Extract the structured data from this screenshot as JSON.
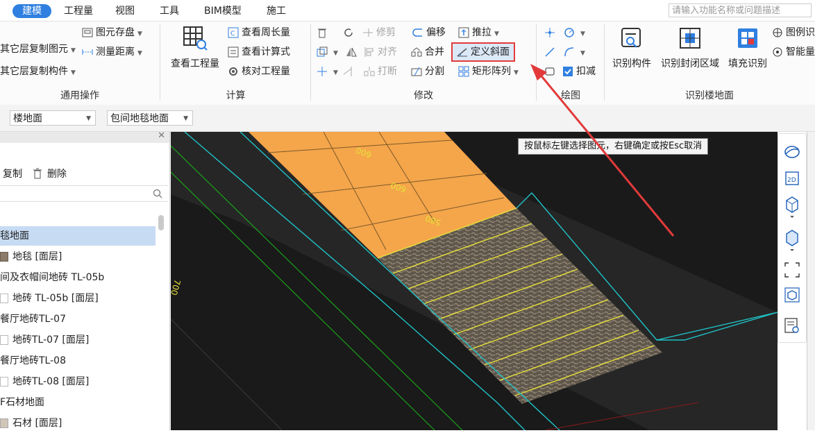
{
  "menu": {
    "tabs": [
      "建模",
      "工程量",
      "视图",
      "工具",
      "BIM模型",
      "施工"
    ],
    "active_tab": "建模",
    "search_placeholder": "请输入功能名称或问题描述"
  },
  "ribbon": {
    "groups": {
      "general": {
        "title": "通用操作",
        "items": [
          "其它层复制图元",
          "其它层复制构件",
          "图元存盘",
          "测量距离"
        ]
      },
      "calc": {
        "title": "计算",
        "big_label": "查看工程量",
        "items": [
          "查看周长量",
          "查看计算式",
          "核对工程量"
        ]
      },
      "modify": {
        "title": "修改",
        "items": [
          "修剪",
          "偏移",
          "推拉",
          "对齐",
          "合并",
          "定义斜面",
          "打断",
          "分割",
          "矩形阵列"
        ]
      },
      "draw": {
        "title": "绘图",
        "items": [
          "扣减"
        ]
      },
      "identify": {
        "title": "识别楼地面",
        "items": [
          "识别构件",
          "识别封闭区域",
          "填充识别",
          "图例识",
          "智能量"
        ]
      }
    }
  },
  "propbar": {
    "select1": "楼地面",
    "select2": "包间地毯地面"
  },
  "leftpanel": {
    "copy_label": "复制",
    "delete_label": "删除",
    "tree": [
      "毯地面",
      "地毯 [面层]",
      "间及衣帽间地砖 TL-05b",
      "地砖 TL-05b [面层]",
      "餐厅地砖TL-07",
      "地砖TL-07 [面层]",
      "餐厅地砖TL-08",
      "地砖TL-08 [面层]",
      "F石材地面",
      "石材 [面层]"
    ],
    "selected_index": 0
  },
  "canvas": {
    "hint": "按鼠标左键选择图元，右键确定或按Esc取消",
    "dimension_labels": [
      "600",
      "600",
      "580",
      "700"
    ]
  },
  "colors": {
    "accent": "#2f7fe0",
    "highlight_border": "#e23a3a",
    "tile_orange": "#f5a54a",
    "cyan_line": "#1fc3c9",
    "yellow_line": "#e8e23a",
    "green_line": "#1aa31a"
  },
  "icons": {
    "view_3d": "globe-icon",
    "view_2d": "2d-icon"
  }
}
